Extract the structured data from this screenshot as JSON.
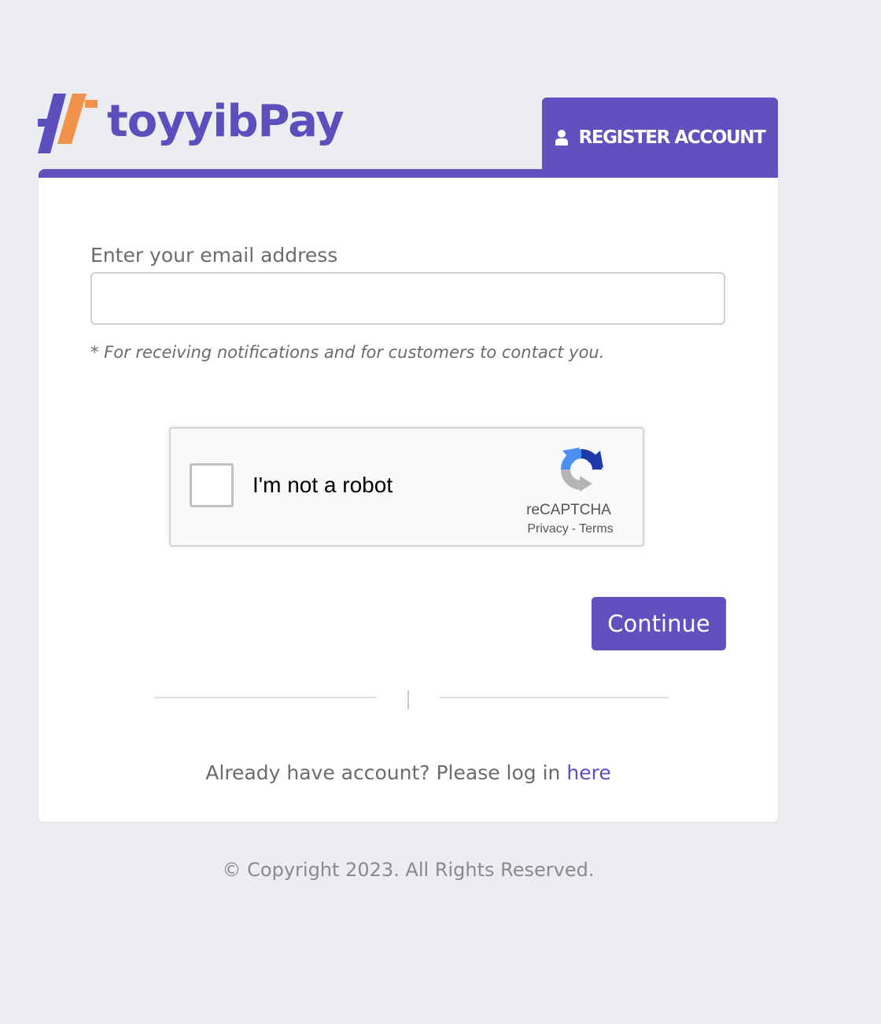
{
  "brand": {
    "name": "toyyibPay",
    "primary_color": "#6150bd",
    "accent_color": "#f0924a"
  },
  "header": {
    "register_tab": {
      "icon": "user-icon",
      "label": "REGISTER ACCOUNT"
    }
  },
  "form": {
    "email_label": "Enter your email address",
    "email_value": "",
    "email_note": "* For receiving notifications and for customers to contact you.",
    "recaptcha": {
      "checkbox_label": "I'm not a robot",
      "checked": false,
      "brand": "reCAPTCHA",
      "privacy": "Privacy",
      "separator": "-",
      "terms": "Terms",
      "icon": "recaptcha-logo-icon"
    },
    "continue_label": "Continue"
  },
  "login": {
    "prompt": "Already have account? Please log in",
    "link_label": "here"
  },
  "footer": {
    "copyright": "© Copyright 2023. All Rights Reserved."
  }
}
